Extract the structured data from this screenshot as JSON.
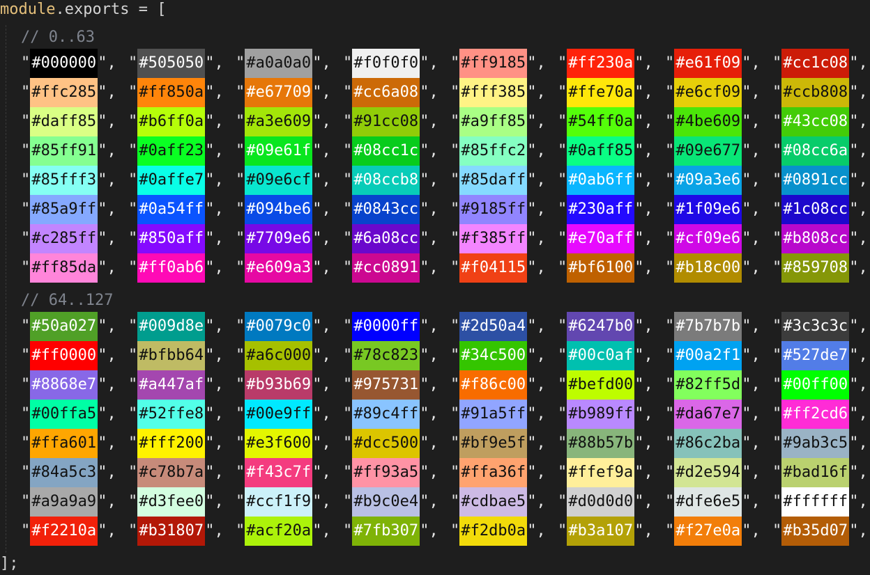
{
  "code": {
    "header_module": "module",
    "header_dot": ".",
    "header_exports": "exports",
    "header_rest": " = [",
    "comment_a": "// 0..63",
    "comment_b": "// 64..127",
    "footer": "];"
  },
  "colors": [
    "#000000",
    "#505050",
    "#a0a0a0",
    "#f0f0f0",
    "#ff9185",
    "#ff230a",
    "#e61f09",
    "#cc1c08",
    "#ffc285",
    "#ff850a",
    "#e67709",
    "#cc6a08",
    "#fff385",
    "#ffe70a",
    "#e6cf09",
    "#ccb808",
    "#daff85",
    "#b6ff0a",
    "#a3e609",
    "#91cc08",
    "#a9ff85",
    "#54ff0a",
    "#4be609",
    "#43cc08",
    "#85ff91",
    "#0aff23",
    "#09e61f",
    "#08cc1c",
    "#85ffc2",
    "#0aff85",
    "#09e677",
    "#08cc6a",
    "#85fff3",
    "#0affe7",
    "#09e6cf",
    "#08ccb8",
    "#85daff",
    "#0ab6ff",
    "#09a3e6",
    "#0891cc",
    "#85a9ff",
    "#0a54ff",
    "#094be6",
    "#0843cc",
    "#9185ff",
    "#230aff",
    "#1f09e6",
    "#1c08cc",
    "#c285ff",
    "#850aff",
    "#7709e6",
    "#6a08cc",
    "#f385ff",
    "#e70aff",
    "#cf09e6",
    "#b808cc",
    "#ff85da",
    "#ff0ab6",
    "#e609a3",
    "#cc0891",
    "#f04115",
    "#bf6100",
    "#b18c00",
    "#859708",
    "#50a027",
    "#009d8e",
    "#0079c0",
    "#0000ff",
    "#2d50a4",
    "#6247b0",
    "#7b7b7b",
    "#3c3c3c",
    "#ff0000",
    "#bfbb64",
    "#a6c000",
    "#78c823",
    "#34c500",
    "#00c0af",
    "#00a2f1",
    "#527de7",
    "#8868e7",
    "#a447af",
    "#b93b69",
    "#975731",
    "#f86c00",
    "#befd00",
    "#82ff5d",
    "#00ff00",
    "#00ffa5",
    "#52ffe8",
    "#00e9ff",
    "#89c4ff",
    "#91a5ff",
    "#b989ff",
    "#da67e7",
    "#ff2cd6",
    "#ffa601",
    "#fff200",
    "#e3f600",
    "#dcc500",
    "#bf9e5f",
    "#88b57b",
    "#86c2ba",
    "#9ab3c5",
    "#84a5c3",
    "#c78b7a",
    "#f43c7f",
    "#ff93a5",
    "#ffa36f",
    "#ffef9a",
    "#d2e594",
    "#bad16f",
    "#a9a9a9",
    "#d3fee0",
    "#ccf1f9",
    "#b9c0e4",
    "#cdbae5",
    "#d0d0d0",
    "#dfe6e5",
    "#ffffff",
    "#f2210a",
    "#b31807",
    "#acf20a",
    "#7fb307",
    "#f2db0a",
    "#b3a107",
    "#f27e0a",
    "#b35d07"
  ]
}
